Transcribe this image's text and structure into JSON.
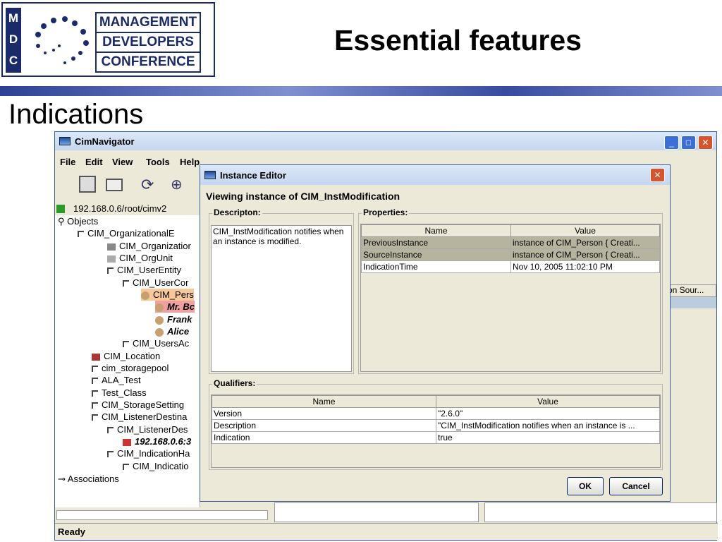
{
  "slide": {
    "logo_letters": [
      "M",
      "D",
      "C"
    ],
    "logo_words": [
      "MANAGEMENT",
      "DEVELOPERS",
      "CONFERENCE"
    ],
    "title": "Essential features",
    "subtitle": "Indications"
  },
  "cimnav": {
    "title": "CimNavigator",
    "menu": [
      "File",
      "Edit",
      "View",
      "Tools",
      "Help"
    ],
    "root": "192.168.0.6/root/cimv2",
    "tree": [
      {
        "label": "Objects"
      },
      {
        "label": "CIM_OrganizationalE"
      },
      {
        "label": "CIM_Organizatior"
      },
      {
        "label": "CIM_OrgUnit"
      },
      {
        "label": "CIM_UserEntity"
      },
      {
        "label": "CIM_UserCor"
      },
      {
        "label": "CIM_Pers"
      },
      {
        "label": "Mr. Bc"
      },
      {
        "label": "Frank"
      },
      {
        "label": "Alice"
      },
      {
        "label": "CIM_UsersAc"
      },
      {
        "label": "CIM_Location"
      },
      {
        "label": "cim_storagepool"
      },
      {
        "label": "ALA_Test"
      },
      {
        "label": "Test_Class"
      },
      {
        "label": "CIM_StorageSetting"
      },
      {
        "label": "CIM_ListenerDestina"
      },
      {
        "label": "CIM_ListenerDes"
      },
      {
        "label": "192.168.0.6:3"
      },
      {
        "label": "CIM_IndicationHa"
      },
      {
        "label": "CIM_Indicatio"
      },
      {
        "label": "Associations"
      }
    ],
    "right_col_header": "on Sour...",
    "status": "Ready"
  },
  "editor": {
    "title": "Instance Editor",
    "heading": "Viewing instance of CIM_InstModification",
    "description_label": "Descripton:",
    "description_text": "CIM_InstModification notifies when an instance is modified.",
    "properties_label": "Properties:",
    "prop_headers": {
      "name": "Name",
      "value": "Value"
    },
    "properties": [
      {
        "name": "PreviousInstance",
        "value": "instance of CIM_Person {    Creati..."
      },
      {
        "name": "SourceInstance",
        "value": "instance of CIM_Person {    Creati..."
      },
      {
        "name": "IndicationTime",
        "value": "Nov 10, 2005 11:02:10 PM"
      }
    ],
    "qualifiers_label": "Qualifiers:",
    "qual_headers": {
      "name": "Name",
      "value": "Value"
    },
    "qualifiers": [
      {
        "name": "Version",
        "value": "\"2.6.0\""
      },
      {
        "name": "Description",
        "value": "\"CIM_InstModification notifies when an instance is ..."
      },
      {
        "name": "Indication",
        "value": "true"
      }
    ],
    "ok": "OK",
    "cancel": "Cancel"
  }
}
